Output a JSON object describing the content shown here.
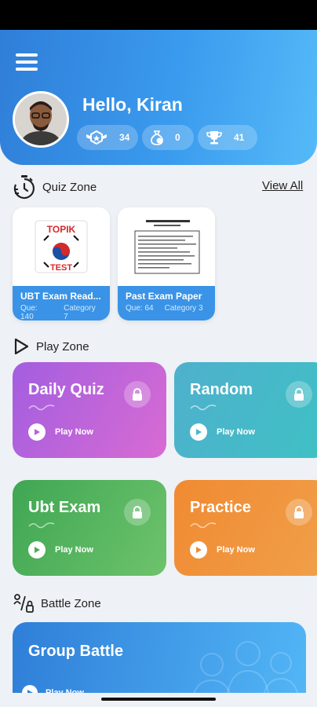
{
  "header": {
    "greeting": "Hello, Kiran",
    "stats": [
      {
        "icon": "rank-badge-icon",
        "value": "34"
      },
      {
        "icon": "coin-bag-icon",
        "value": "0"
      },
      {
        "icon": "trophy-icon",
        "value": "41"
      }
    ]
  },
  "quiz_zone": {
    "title": "Quiz Zone",
    "view_all": "View All",
    "cards": [
      {
        "title": "UBT Exam Read...",
        "que": "Que: 140",
        "category": "Category 7",
        "thumb_text_1": "TOPIK",
        "thumb_text_2": "TEST"
      },
      {
        "title": "Past Exam Paper",
        "que": "Que: 64",
        "category": "Category 3"
      }
    ]
  },
  "play_zone": {
    "title": "Play Zone",
    "cards": [
      {
        "title": "Daily Quiz",
        "action": "Play Now"
      },
      {
        "title": "Random",
        "action": "Play Now"
      },
      {
        "title": "Ubt Exam",
        "action": "Play Now"
      },
      {
        "title": "Practice",
        "action": "Play Now"
      }
    ]
  },
  "battle_zone": {
    "title": "Battle Zone",
    "card": {
      "title": "Group Battle",
      "action": "Play Now"
    }
  },
  "colors": {
    "header_start": "#2f7ed8",
    "header_end": "#55baf8",
    "daily_quiz": "#a35ee0",
    "random": "#3ec1c4",
    "ubt_exam": "#3fa653",
    "practice": "#f08a32"
  }
}
